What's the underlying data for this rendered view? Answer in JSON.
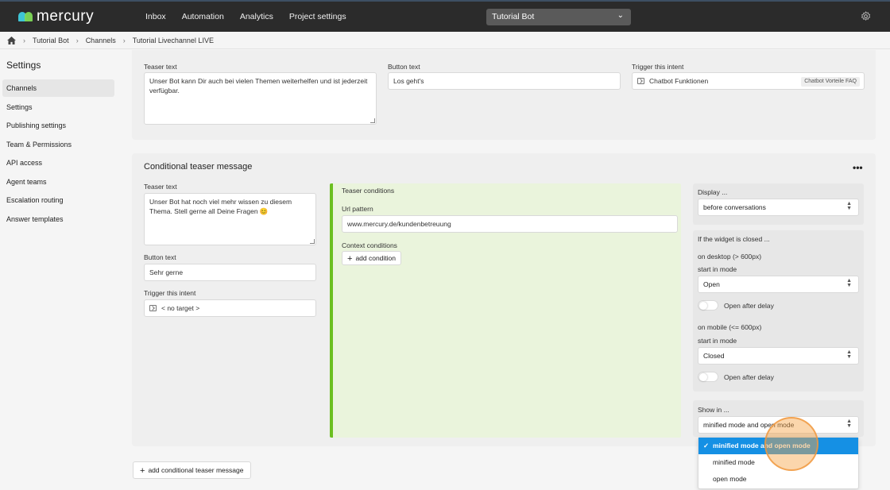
{
  "app": {
    "brand": "mercury",
    "nav": [
      "Inbox",
      "Automation",
      "Analytics",
      "Project settings"
    ],
    "bot_select": "Tutorial Bot"
  },
  "breadcrumb": [
    "Tutorial Bot",
    "Channels",
    "Tutorial Livechannel LIVE"
  ],
  "sidebar": {
    "title": "Settings",
    "items": [
      {
        "label": "Channels",
        "active": true
      },
      {
        "label": "Settings"
      },
      {
        "label": "Publishing settings"
      },
      {
        "label": "Team & Permissions"
      },
      {
        "label": "API access"
      },
      {
        "label": "Agent teams"
      },
      {
        "label": "Escalation routing"
      },
      {
        "label": "Answer templates"
      }
    ]
  },
  "teaser": {
    "teaser_text_label": "Teaser text",
    "teaser_text_value": "Unser Bot kann Dir auch bei vielen Themen weiterhelfen und ist jederzeit  verfügbar.",
    "button_text_label": "Button text",
    "button_text_value": "Los geht's",
    "trigger_label": "Trigger this intent",
    "trigger_value": "Chatbot Funktionen",
    "trigger_tag": "Chatbot Vorteile FAQ"
  },
  "conditional": {
    "title": "Conditional teaser message",
    "more": "•••",
    "teaser_text_label": "Teaser text",
    "teaser_text_value": "Unser Bot hat noch viel mehr wissen zu diesem Thema. Stell gerne all Deine Fragen 😊",
    "button_text_label": "Button text",
    "button_text_value": "Sehr gerne",
    "trigger_label": "Trigger this intent",
    "trigger_value": "< no target >",
    "conditions_title": "Teaser conditions",
    "url_label": "Url pattern",
    "url_value": "www.mercury.de/kundenbetreuung",
    "context_label": "Context conditions",
    "add_condition": "add condition",
    "display_label": "Display ...",
    "display_value": "before conversations",
    "closed_label": "If the widget is closed ...",
    "desktop_label": "on desktop (> 600px)",
    "desktop_mode_label": "start in mode",
    "desktop_mode_value": "Open",
    "desktop_delay": "Open after delay",
    "mobile_label": "on mobile (<= 600px)",
    "mobile_mode_label": "start in mode",
    "mobile_mode_value": "Closed",
    "mobile_delay": "Open after delay",
    "show_in_label": "Show in ...",
    "show_in_value": "minified mode and open mode",
    "show_in_options": [
      "minified mode and open mode",
      "minified mode",
      "open mode"
    ]
  },
  "add_conditional": "add conditional teaser message",
  "colors": {
    "topbar": "#2b2b2b",
    "accent_green": "#6bbf1f",
    "selection_blue": "#1590e4"
  }
}
